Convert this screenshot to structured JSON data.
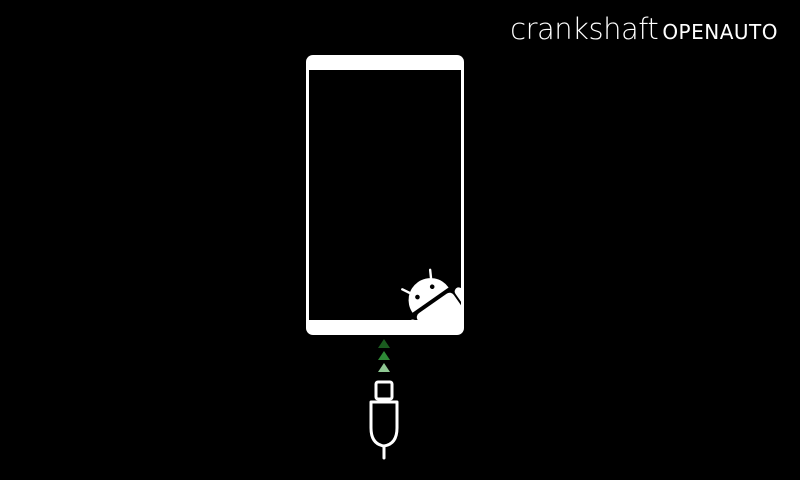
{
  "brand": {
    "primary": "crankshaft",
    "secondary": "OPENAUTO"
  },
  "icons": {
    "phone": "phone-outline-icon",
    "android": "android-robot-icon",
    "arrows": "upload-arrows-icon",
    "plug": "usb-plug-icon"
  },
  "colors": {
    "background": "#000000",
    "foreground": "#ffffff",
    "arrow_dark": "#1a5c1f",
    "arrow_mid": "#2e8a36",
    "arrow_light": "#8fc893"
  }
}
